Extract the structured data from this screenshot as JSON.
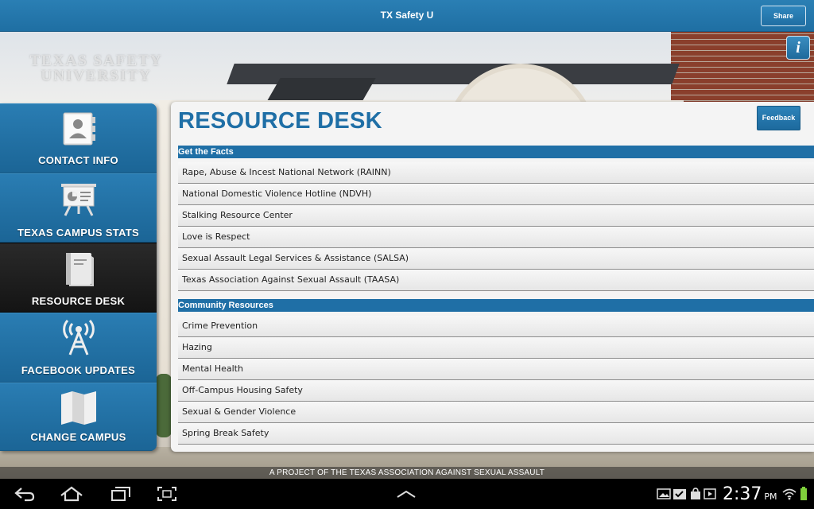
{
  "app": {
    "title": "TX Safety U",
    "share_label": "Share",
    "logo_line1": "TEXAS SAFETY",
    "logo_line2": "UNIVERSITY",
    "info_label": "i"
  },
  "sidebar": {
    "items": [
      {
        "label": "CONTACT INFO",
        "icon": "contact-book-icon"
      },
      {
        "label": "TEXAS CAMPUS STATS",
        "icon": "presentation-board-icon"
      },
      {
        "label": "RESOURCE DESK",
        "icon": "book-icon",
        "active": true
      },
      {
        "label": "FACEBOOK UPDATES",
        "icon": "broadcast-tower-icon"
      },
      {
        "label": "CHANGE CAMPUS",
        "icon": "map-icon"
      }
    ]
  },
  "main": {
    "title": "RESOURCE DESK",
    "feedback_label": "Feedback",
    "sections": [
      {
        "header": "Get the Facts",
        "items": [
          "Rape, Abuse & Incest National Network (RAINN)",
          "National Domestic Violence Hotline (NDVH)",
          "Stalking Resource Center",
          "Love is Respect",
          "Sexual Assault Legal Services & Assistance (SALSA)",
          "Texas Association Against Sexual Assault (TAASA)"
        ]
      },
      {
        "header": "Community Resources",
        "items": [
          "Crime Prevention",
          "Hazing",
          "Mental Health",
          "Off-Campus Housing Safety",
          "Sexual & Gender Violence",
          "Spring Break Safety"
        ]
      }
    ]
  },
  "footer": {
    "text": "A PROJECT OF THE TEXAS ASSOCIATION AGAINST SEXUAL ASSAULT"
  },
  "system_bar": {
    "time": "2:37",
    "ampm": "PM",
    "nav_icons": [
      "back-icon",
      "home-icon",
      "recent-apps-icon",
      "screenshot-icon"
    ],
    "center_icon": "chevron-up-icon",
    "status_icons": [
      "gallery-icon",
      "checklist-icon",
      "bag-icon",
      "play-icon",
      "sync-icon",
      "wifi-icon",
      "battery-icon"
    ]
  },
  "colors": {
    "brand_blue": "#1f6fa6",
    "active_nav": "#1a1a1a"
  }
}
